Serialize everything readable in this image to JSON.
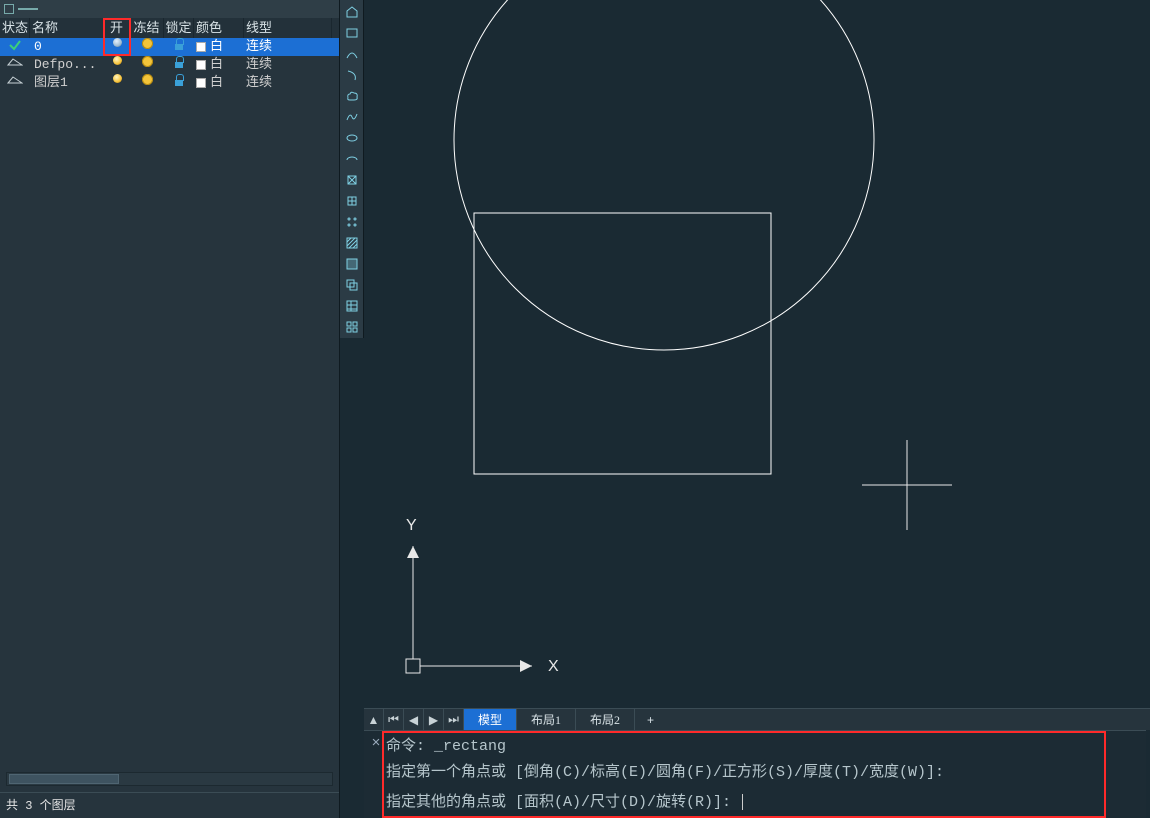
{
  "layer_panel": {
    "headers": {
      "state": "状态",
      "name": "名称",
      "on": "开",
      "freeze": "冻结",
      "lock": "锁定",
      "color": "颜色",
      "linetype": "线型"
    },
    "rows": [
      {
        "name": "0",
        "color_label": "白",
        "linetype": "连续",
        "selected": true,
        "current": true,
        "bulb": "grey"
      },
      {
        "name": "Defpo...",
        "color_label": "白",
        "linetype": "连续",
        "selected": false,
        "current": false,
        "bulb": "yellow"
      },
      {
        "name": "图层1",
        "color_label": "白",
        "linetype": "连续",
        "selected": false,
        "current": false,
        "bulb": "yellow"
      }
    ],
    "status": "共 3 个图层"
  },
  "tabs": {
    "items": [
      {
        "label": "模型",
        "active": true
      },
      {
        "label": "布局1",
        "active": false
      },
      {
        "label": "布局2",
        "active": false
      }
    ],
    "plus": "+"
  },
  "command": {
    "line1": "命令: _rectang",
    "line2": "指定第一个角点或 [倒角(C)/标高(E)/圆角(F)/正方形(S)/厚度(T)/宽度(W)]:",
    "line3": "指定其他的角点或 [面积(A)/尺寸(D)/旋转(R)]:"
  },
  "axes": {
    "x": "X",
    "y": "Y"
  }
}
